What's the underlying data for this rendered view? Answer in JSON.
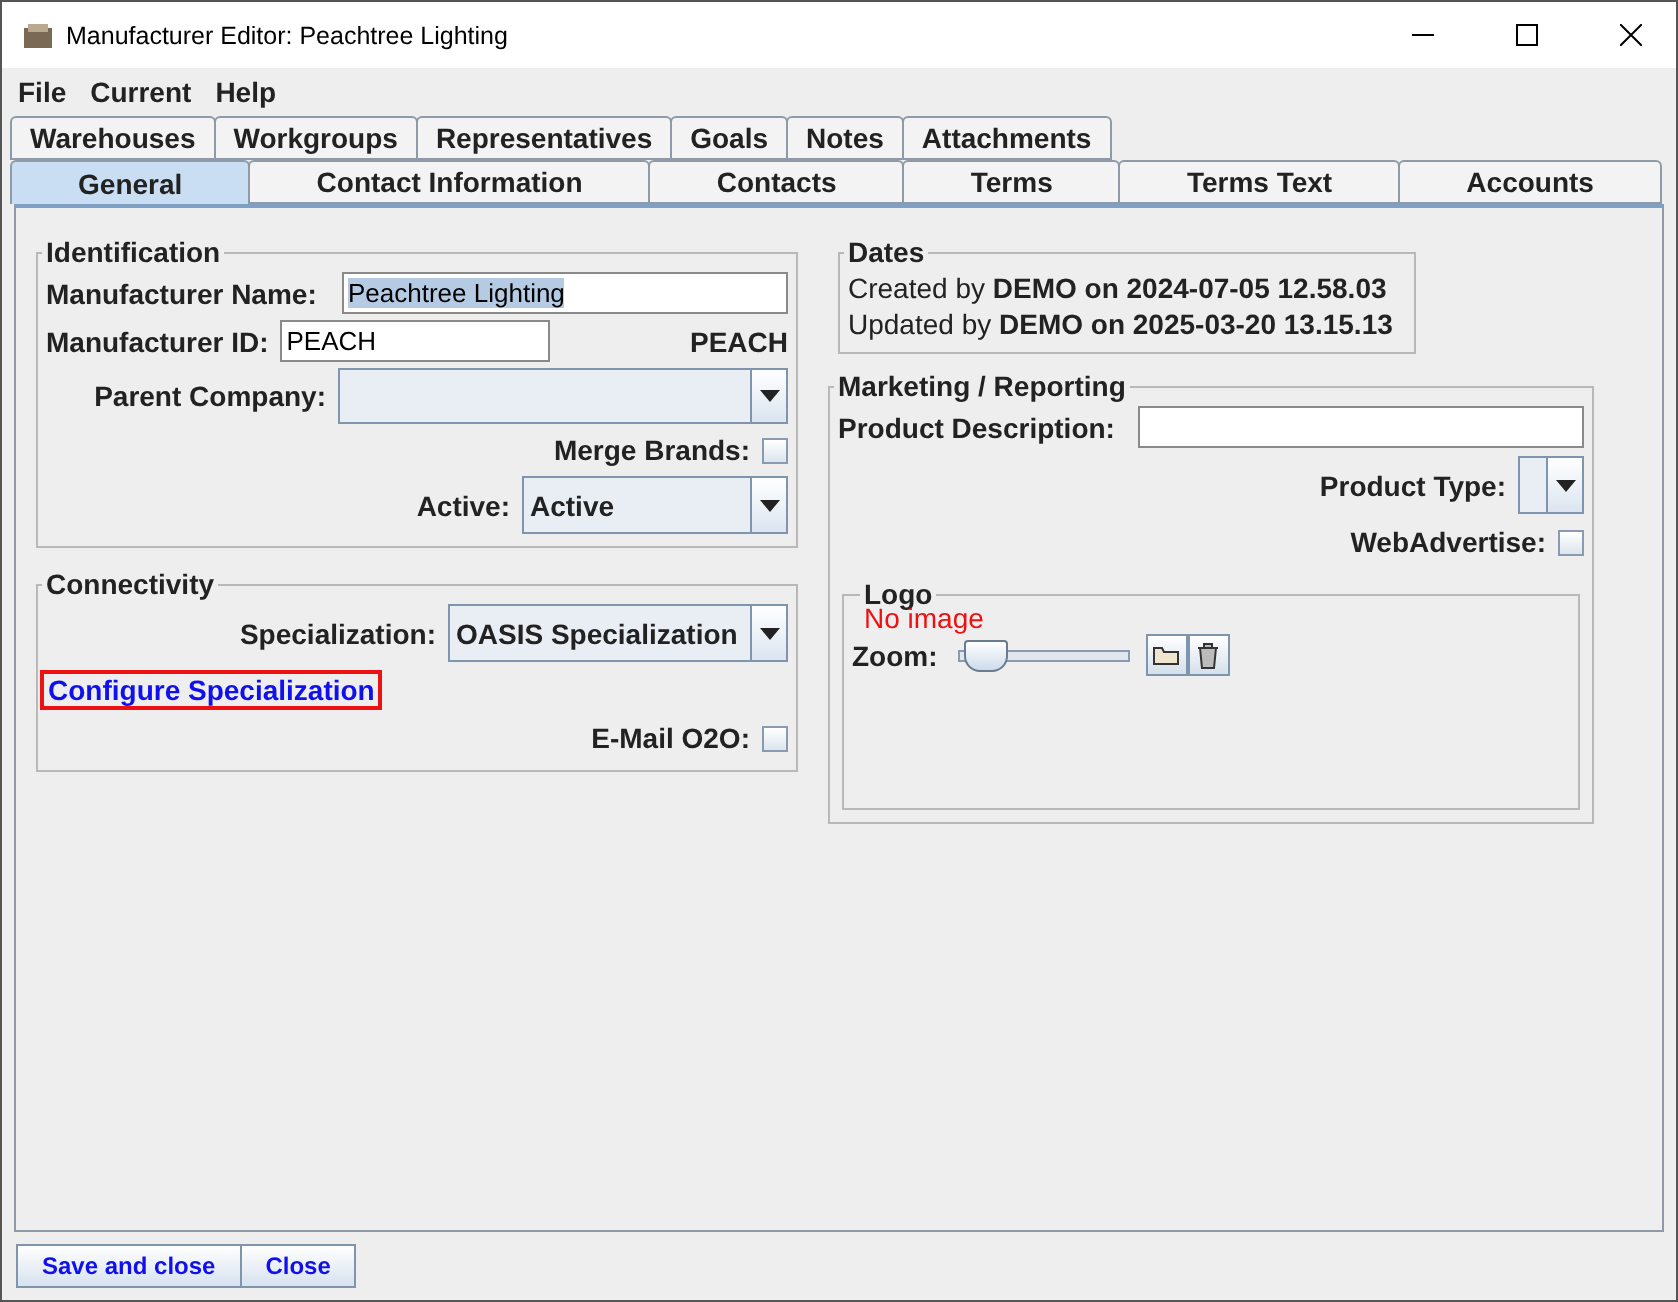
{
  "window": {
    "title": "Manufacturer Editor: Peachtree Lighting"
  },
  "menu": [
    "File",
    "Current",
    "Help"
  ],
  "tab_rows": [
    [
      {
        "label": "Warehouses",
        "selected": false
      },
      {
        "label": "Workgroups",
        "selected": false
      },
      {
        "label": "Representatives",
        "selected": false
      },
      {
        "label": "Goals",
        "selected": false
      },
      {
        "label": "Notes",
        "selected": false
      },
      {
        "label": "Attachments",
        "selected": false
      }
    ],
    [
      {
        "label": "General",
        "selected": true
      },
      {
        "label": "Contact Information",
        "selected": false
      },
      {
        "label": "Contacts",
        "selected": false
      },
      {
        "label": "Terms",
        "selected": false
      },
      {
        "label": "Terms Text",
        "selected": false
      },
      {
        "label": "Accounts",
        "selected": false
      }
    ]
  ],
  "identification": {
    "title": "Identification",
    "name_label": "Manufacturer Name:",
    "name_value": "Peachtree Lighting",
    "id_label": "Manufacturer ID:",
    "id_value": "PEACH",
    "id_code": "PEACH",
    "parent_label": "Parent Company:",
    "merge_label": "Merge Brands:",
    "merge_checked": false,
    "active_label": "Active:",
    "active_value": "Active"
  },
  "connectivity": {
    "title": "Connectivity",
    "specialization_label": "Specialization:",
    "specialization_value": "OASIS Specialization",
    "configure_link": "Configure Specialization",
    "email_label": "E-Mail O2O:",
    "email_checked": false
  },
  "dates": {
    "title": "Dates",
    "lines": [
      {
        "prefix": "Created by",
        "user": "DEMO",
        "on": "on",
        "stamp": "2024-07-05 12.58.03"
      },
      {
        "prefix": "Updated by",
        "user": "DEMO",
        "on": "on",
        "stamp": "2025-03-20 13.15.13"
      }
    ]
  },
  "marketing": {
    "title": "Marketing / Reporting",
    "description_label": "Product Description:",
    "type_label": "Product Type:",
    "web_label": "WebAdvertise:",
    "web_checked": false,
    "logo": {
      "title": "Logo",
      "message": "No image",
      "zoom_label": "Zoom:",
      "level": 0.17
    }
  },
  "buttons": [
    "Save and close",
    "Close"
  ]
}
